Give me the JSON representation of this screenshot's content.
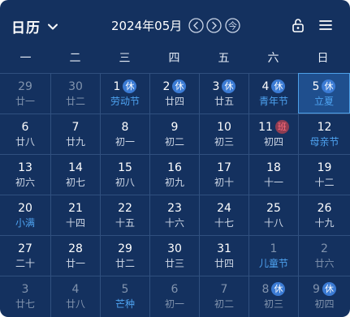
{
  "header": {
    "view_label": "日历",
    "month_title": "2024年05月",
    "today_label": "今"
  },
  "icons": {
    "view_dropdown": "chevron-down-icon",
    "prev": "chevron-left-circle-icon",
    "next": "chevron-right-circle-icon",
    "today": "today-circle-icon",
    "lock": "unlock-icon",
    "menu": "menu-icon"
  },
  "weekdays": [
    "一",
    "二",
    "三",
    "四",
    "五",
    "六",
    "日"
  ],
  "colors": {
    "background": "#14315f",
    "grid_line": "#30507f",
    "festival_text": "#4ea3f1",
    "rest_badge": "#3b7bd4",
    "work_badge": "#8e3d52",
    "selected_border": "#4da0e8"
  },
  "days": [
    {
      "day": "29",
      "sub": "廿一",
      "other_month": true
    },
    {
      "day": "30",
      "sub": "廿二",
      "other_month": true
    },
    {
      "day": "1",
      "sub": "劳动节",
      "badge": "休",
      "festival": true
    },
    {
      "day": "2",
      "sub": "廿四",
      "badge": "休"
    },
    {
      "day": "3",
      "sub": "廿五",
      "badge": "休"
    },
    {
      "day": "4",
      "sub": "青年节",
      "badge": "休",
      "festival": true
    },
    {
      "day": "5",
      "sub": "立夏",
      "badge": "休",
      "festival": true,
      "selected": true
    },
    {
      "day": "6",
      "sub": "廿八"
    },
    {
      "day": "7",
      "sub": "廿九"
    },
    {
      "day": "8",
      "sub": "初一"
    },
    {
      "day": "9",
      "sub": "初二"
    },
    {
      "day": "10",
      "sub": "初三"
    },
    {
      "day": "11",
      "sub": "初四",
      "badge": "班",
      "badge_type": "work"
    },
    {
      "day": "12",
      "sub": "母亲节",
      "festival": true
    },
    {
      "day": "13",
      "sub": "初六"
    },
    {
      "day": "14",
      "sub": "初七"
    },
    {
      "day": "15",
      "sub": "初八"
    },
    {
      "day": "16",
      "sub": "初九"
    },
    {
      "day": "17",
      "sub": "初十"
    },
    {
      "day": "18",
      "sub": "十一"
    },
    {
      "day": "19",
      "sub": "十二"
    },
    {
      "day": "20",
      "sub": "小满",
      "festival": true
    },
    {
      "day": "21",
      "sub": "十四"
    },
    {
      "day": "22",
      "sub": "十五"
    },
    {
      "day": "23",
      "sub": "十六"
    },
    {
      "day": "24",
      "sub": "十七"
    },
    {
      "day": "25",
      "sub": "十八"
    },
    {
      "day": "26",
      "sub": "十九"
    },
    {
      "day": "27",
      "sub": "二十"
    },
    {
      "day": "28",
      "sub": "廿一"
    },
    {
      "day": "29",
      "sub": "廿二"
    },
    {
      "day": "30",
      "sub": "廿三"
    },
    {
      "day": "31",
      "sub": "廿四"
    },
    {
      "day": "1",
      "sub": "儿童节",
      "other_month": true,
      "festival": true
    },
    {
      "day": "2",
      "sub": "廿六",
      "other_month": true
    },
    {
      "day": "3",
      "sub": "廿七",
      "other_month": true
    },
    {
      "day": "4",
      "sub": "廿八",
      "other_month": true
    },
    {
      "day": "5",
      "sub": "芒种",
      "other_month": true,
      "festival": true
    },
    {
      "day": "6",
      "sub": "初一",
      "other_month": true
    },
    {
      "day": "7",
      "sub": "初二",
      "other_month": true
    },
    {
      "day": "8",
      "sub": "初三",
      "other_month": true,
      "badge": "休"
    },
    {
      "day": "9",
      "sub": "初四",
      "other_month": true,
      "badge": "休"
    }
  ]
}
